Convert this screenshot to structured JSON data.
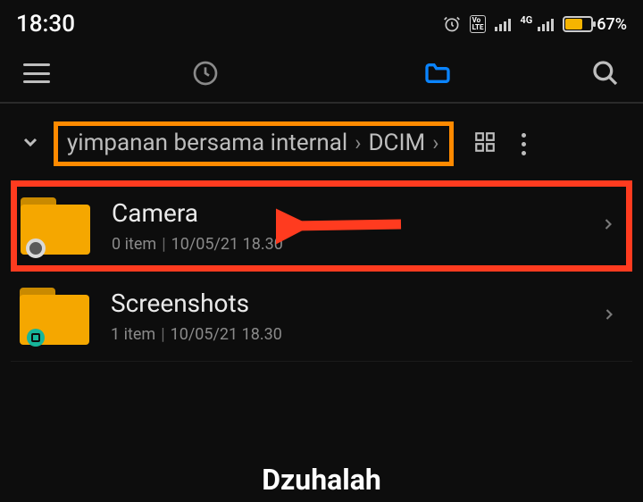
{
  "status": {
    "time": "18:30",
    "volte": "Vo LTE",
    "net_label": "4G",
    "battery_pct": "67%"
  },
  "breadcrumb": {
    "seg1": "yimpanan bersama internal",
    "seg2": "DCIM"
  },
  "folders": [
    {
      "name": "Camera",
      "items": "0 item",
      "date": "10/05/21 18.30"
    },
    {
      "name": "Screenshots",
      "items": "1 item",
      "date": "10/05/21 18.30"
    }
  ],
  "watermark": "Dzuhalah"
}
